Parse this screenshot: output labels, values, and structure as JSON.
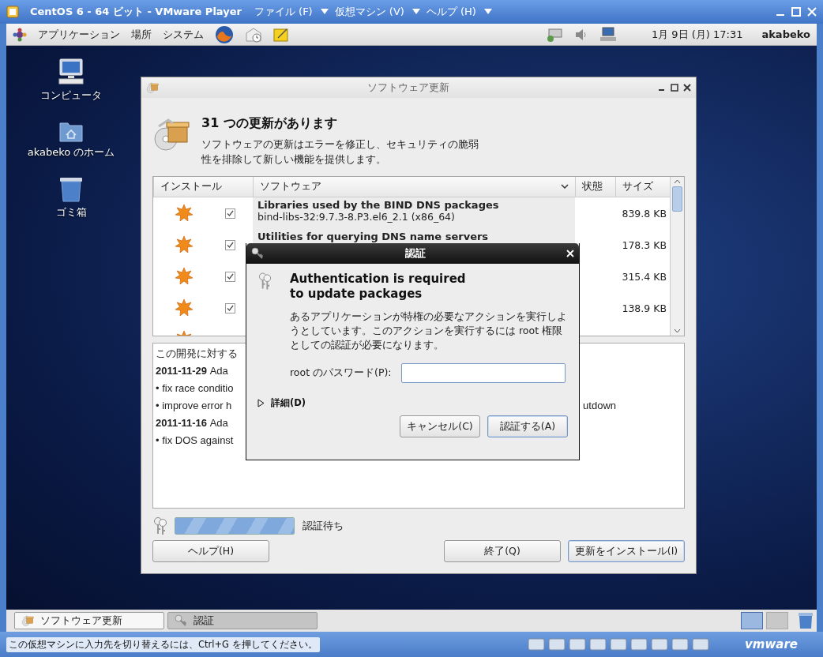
{
  "vmware": {
    "title": "CentOS 6 - 64 ビット - VMware Player",
    "menus": [
      "ファイル (F)",
      "仮想マシン (V)",
      "ヘルプ (H)"
    ]
  },
  "top_panel": {
    "menus": [
      "アプリケーション",
      "場所",
      "システム"
    ],
    "clock": "1月 9日 (月) 17:31",
    "user": "akabeko"
  },
  "desktop_icons": [
    {
      "kind": "computer",
      "label": "コンピュータ"
    },
    {
      "kind": "home",
      "label": "akabeko のホーム"
    },
    {
      "kind": "trash",
      "label": "ゴミ箱"
    }
  ],
  "update_window": {
    "title": "ソフトウェア更新",
    "heading": "31 つの更新があります",
    "description": "ソフトウェアの更新はエラーを修正し、セキュリティの脆弱性を排除して新しい機能を提供します。",
    "columns": [
      "インストール",
      "ソフトウェア",
      "状態",
      "サイズ"
    ],
    "rows": [
      {
        "checked": true,
        "name": "Libraries used by the BIND DNS packages",
        "package": "bind-libs-32:9.7.3-8.P3.el6_2.1 (x86_64)",
        "size": "839.8 KB"
      },
      {
        "checked": true,
        "name": "Utilities for querying DNS name servers",
        "size": "178.3 KB"
      },
      {
        "checked": true,
        "size": "315.4 KB"
      },
      {
        "checked": true,
        "size": "138.9 KB"
      }
    ],
    "changelog": [
      {
        "kind": "text",
        "text": "この開発に対する"
      },
      {
        "kind": "entry",
        "date": "2011-11-29",
        "text": "Ada"
      },
      {
        "kind": "bullet",
        "text": "• fix race conditio"
      },
      {
        "kind": "bullet",
        "text": "• improve error h",
        "tail": "utdown"
      },
      {
        "kind": "entry",
        "date": "2011-11-16",
        "text": "Ada"
      },
      {
        "kind": "bullet",
        "text": "• fix DOS against"
      }
    ],
    "progress": {
      "level": 1,
      "status": "認証待ち"
    },
    "buttons": [
      {
        "label": "ヘルプ(H)",
        "default": false
      },
      {
        "label": "終了(Q)",
        "default": false
      },
      {
        "label": "更新をインストール(I)",
        "default": true
      }
    ]
  },
  "auth_dialog": {
    "title": "認証",
    "heading": "Authentication is required\nto update packages",
    "message": "あるアプリケーションが特権の必要なアクションを実行しようとしています。このアクションを実行するには root 権限としての認証が必要になります。",
    "password_label": "root のパスワード(P):",
    "details": {
      "label": "詳細(D)",
      "expanded": false
    },
    "buttons": [
      {
        "label": "キャンセル(C)",
        "default": false
      },
      {
        "label": "認証する(A)",
        "default": true
      }
    ]
  },
  "taskbar": [
    {
      "kind": "updater",
      "label": "ソフトウェア更新",
      "selected": false
    },
    {
      "kind": "auth",
      "label": "認証",
      "selected": true
    }
  ],
  "workspaces": [
    {
      "selected": true
    },
    {
      "selected": false
    }
  ],
  "status_bar": {
    "hint": "この仮想マシンに入力先を切り替えるには、Ctrl+G を押してください。",
    "logo": "vmware"
  }
}
